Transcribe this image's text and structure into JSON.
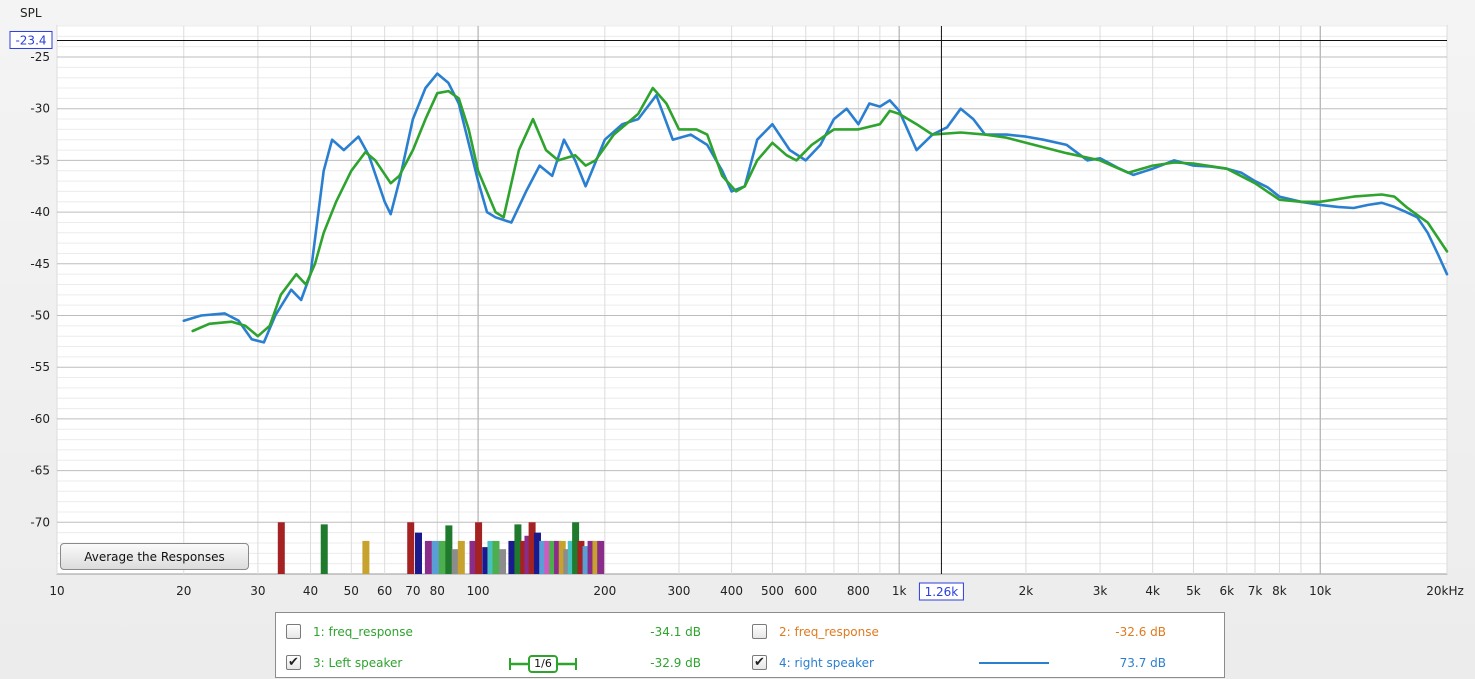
{
  "chart_data": {
    "type": "line",
    "ylabel": "SPL",
    "xlabel": "",
    "x_scale": "log",
    "xlim": [
      10,
      20000
    ],
    "ylim": [
      -75,
      -22
    ],
    "x_ticks": [
      {
        "v": 10,
        "label": "10"
      },
      {
        "v": 20,
        "label": "20"
      },
      {
        "v": 30,
        "label": "30"
      },
      {
        "v": 40,
        "label": "40"
      },
      {
        "v": 50,
        "label": "50"
      },
      {
        "v": 60,
        "label": "60"
      },
      {
        "v": 70,
        "label": "70"
      },
      {
        "v": 80,
        "label": "80"
      },
      {
        "v": 100,
        "label": "100"
      },
      {
        "v": 200,
        "label": "200"
      },
      {
        "v": 300,
        "label": "300"
      },
      {
        "v": 400,
        "label": "400"
      },
      {
        "v": 500,
        "label": "500"
      },
      {
        "v": 600,
        "label": "600"
      },
      {
        "v": 800,
        "label": "800"
      },
      {
        "v": 1000,
        "label": "1k"
      },
      {
        "v": 2000,
        "label": "2k"
      },
      {
        "v": 3000,
        "label": "3k"
      },
      {
        "v": 4000,
        "label": "4k"
      },
      {
        "v": 5000,
        "label": "5k"
      },
      {
        "v": 6000,
        "label": "6k"
      },
      {
        "v": 7000,
        "label": "7k"
      },
      {
        "v": 8000,
        "label": "8k"
      },
      {
        "v": 10000,
        "label": "10k"
      },
      {
        "v": 20000,
        "label": "20kHz"
      }
    ],
    "y_ticks": [
      -25,
      -30,
      -35,
      -40,
      -45,
      -50,
      -55,
      -60,
      -65,
      -70
    ],
    "grid": true,
    "cursor": {
      "x": 1260,
      "y": -23.4,
      "x_label": "1.26k",
      "y_label": "-23.4"
    },
    "series": [
      {
        "name": "right speaker",
        "color": "#2b7fd0",
        "points": [
          [
            20,
            -50.5
          ],
          [
            22,
            -50
          ],
          [
            25,
            -49.8
          ],
          [
            27,
            -50.5
          ],
          [
            29,
            -52.3
          ],
          [
            31,
            -52.6
          ],
          [
            33,
            -50
          ],
          [
            36,
            -47.5
          ],
          [
            38,
            -48.5
          ],
          [
            40,
            -46
          ],
          [
            43,
            -36
          ],
          [
            45,
            -33
          ],
          [
            48,
            -34
          ],
          [
            52,
            -32.7
          ],
          [
            55,
            -34.5
          ],
          [
            60,
            -39
          ],
          [
            62,
            -40.2
          ],
          [
            65,
            -37
          ],
          [
            70,
            -31
          ],
          [
            75,
            -28
          ],
          [
            80,
            -26.6
          ],
          [
            85,
            -27.5
          ],
          [
            90,
            -29.5
          ],
          [
            100,
            -37
          ],
          [
            105,
            -40
          ],
          [
            110,
            -40.5
          ],
          [
            120,
            -41
          ],
          [
            130,
            -38
          ],
          [
            140,
            -35.5
          ],
          [
            150,
            -36.5
          ],
          [
            160,
            -33
          ],
          [
            170,
            -35
          ],
          [
            180,
            -37.5
          ],
          [
            200,
            -33
          ],
          [
            220,
            -31.5
          ],
          [
            240,
            -31
          ],
          [
            265,
            -28.7
          ],
          [
            290,
            -33
          ],
          [
            320,
            -32.5
          ],
          [
            350,
            -33.5
          ],
          [
            380,
            -36
          ],
          [
            400,
            -38
          ],
          [
            430,
            -37.5
          ],
          [
            460,
            -33
          ],
          [
            500,
            -31.5
          ],
          [
            550,
            -34
          ],
          [
            600,
            -35
          ],
          [
            650,
            -33.5
          ],
          [
            700,
            -31
          ],
          [
            750,
            -30
          ],
          [
            800,
            -31.5
          ],
          [
            850,
            -29.5
          ],
          [
            900,
            -29.8
          ],
          [
            950,
            -29.2
          ],
          [
            1000,
            -30.2
          ],
          [
            1100,
            -34
          ],
          [
            1200,
            -32.5
          ],
          [
            1300,
            -31.8
          ],
          [
            1400,
            -30
          ],
          [
            1500,
            -31
          ],
          [
            1600,
            -32.5
          ],
          [
            1800,
            -32.5
          ],
          [
            2000,
            -32.7
          ],
          [
            2200,
            -33
          ],
          [
            2500,
            -33.5
          ],
          [
            2800,
            -35
          ],
          [
            3000,
            -34.8
          ],
          [
            3300,
            -35.7
          ],
          [
            3600,
            -36.4
          ],
          [
            4000,
            -35.8
          ],
          [
            4500,
            -35
          ],
          [
            5000,
            -35.5
          ],
          [
            5500,
            -35.6
          ],
          [
            6000,
            -35.8
          ],
          [
            6500,
            -36.2
          ],
          [
            7000,
            -37
          ],
          [
            7500,
            -37.6
          ],
          [
            8000,
            -38.5
          ],
          [
            9000,
            -39
          ],
          [
            10000,
            -39.3
          ],
          [
            11000,
            -39.5
          ],
          [
            12000,
            -39.6
          ],
          [
            13000,
            -39.3
          ],
          [
            14000,
            -39.1
          ],
          [
            15000,
            -39.5
          ],
          [
            16000,
            -40
          ],
          [
            17000,
            -40.5
          ],
          [
            18000,
            -42
          ],
          [
            19000,
            -44
          ],
          [
            20000,
            -46
          ]
        ]
      },
      {
        "name": "Left speaker",
        "color": "#2ea32e",
        "points": [
          [
            21,
            -51.5
          ],
          [
            23,
            -50.8
          ],
          [
            26,
            -50.6
          ],
          [
            28,
            -51
          ],
          [
            30,
            -52
          ],
          [
            32,
            -51
          ],
          [
            34,
            -48
          ],
          [
            37,
            -46
          ],
          [
            39,
            -47
          ],
          [
            41,
            -45
          ],
          [
            43,
            -42
          ],
          [
            46,
            -39
          ],
          [
            50,
            -36
          ],
          [
            54,
            -34.2
          ],
          [
            57,
            -35
          ],
          [
            62,
            -37.2
          ],
          [
            65,
            -36.5
          ],
          [
            70,
            -34
          ],
          [
            75,
            -31
          ],
          [
            80,
            -28.5
          ],
          [
            85,
            -28.3
          ],
          [
            90,
            -29
          ],
          [
            95,
            -32
          ],
          [
            100,
            -36
          ],
          [
            110,
            -40
          ],
          [
            115,
            -40.5
          ],
          [
            125,
            -34
          ],
          [
            135,
            -31
          ],
          [
            145,
            -34
          ],
          [
            155,
            -35
          ],
          [
            170,
            -34.5
          ],
          [
            180,
            -35.5
          ],
          [
            190,
            -35
          ],
          [
            210,
            -32.5
          ],
          [
            240,
            -30.5
          ],
          [
            260,
            -28
          ],
          [
            280,
            -29.5
          ],
          [
            300,
            -32
          ],
          [
            330,
            -32
          ],
          [
            350,
            -32.5
          ],
          [
            380,
            -36.5
          ],
          [
            410,
            -38
          ],
          [
            430,
            -37.5
          ],
          [
            460,
            -35
          ],
          [
            500,
            -33.3
          ],
          [
            540,
            -34.5
          ],
          [
            570,
            -35
          ],
          [
            620,
            -33.5
          ],
          [
            700,
            -32
          ],
          [
            800,
            -32
          ],
          [
            900,
            -31.5
          ],
          [
            950,
            -30.2
          ],
          [
            1000,
            -30.5
          ],
          [
            1100,
            -31.5
          ],
          [
            1200,
            -32.5
          ],
          [
            1400,
            -32.3
          ],
          [
            1600,
            -32.5
          ],
          [
            1800,
            -32.8
          ],
          [
            2000,
            -33.3
          ],
          [
            2500,
            -34.3
          ],
          [
            3000,
            -35
          ],
          [
            3500,
            -36.2
          ],
          [
            4000,
            -35.5
          ],
          [
            4500,
            -35.2
          ],
          [
            5000,
            -35.3
          ],
          [
            6000,
            -35.8
          ],
          [
            7000,
            -37.2
          ],
          [
            8000,
            -38.8
          ],
          [
            9000,
            -39
          ],
          [
            10000,
            -39
          ],
          [
            12000,
            -38.5
          ],
          [
            14000,
            -38.3
          ],
          [
            15000,
            -38.5
          ],
          [
            16000,
            -39.5
          ],
          [
            18000,
            -41
          ],
          [
            20000,
            -43.8
          ]
        ]
      }
    ],
    "markers": [
      {
        "f": 34,
        "h": -70,
        "c": "#a52222"
      },
      {
        "f": 43,
        "h": -70.2,
        "c": "#1f7a2e"
      },
      {
        "f": 54,
        "h": -71.8,
        "c": "#c8a22e"
      },
      {
        "f": 69,
        "h": -70,
        "c": "#a52222"
      },
      {
        "f": 72,
        "h": -71,
        "c": "#1a1a8c"
      },
      {
        "f": 76,
        "h": -71.8,
        "c": "#8a2d8a"
      },
      {
        "f": 79,
        "h": -71.8,
        "c": "#5a9ed6"
      },
      {
        "f": 82,
        "h": -71.8,
        "c": "#4cae4c"
      },
      {
        "f": 85,
        "h": -70.3,
        "c": "#1f7a2e"
      },
      {
        "f": 88,
        "h": -72.6,
        "c": "#8c8c8c"
      },
      {
        "f": 91,
        "h": -71.8,
        "c": "#c8a22e"
      },
      {
        "f": 97,
        "h": -71.8,
        "c": "#8a2d8a"
      },
      {
        "f": 100,
        "h": -70,
        "c": "#a52222"
      },
      {
        "f": 104,
        "h": -72.4,
        "c": "#1a1a8c"
      },
      {
        "f": 107,
        "h": -71.8,
        "c": "#46c0c0"
      },
      {
        "f": 110,
        "h": -71.8,
        "c": "#4cae4c"
      },
      {
        "f": 114,
        "h": -72.6,
        "c": "#8c8c8c"
      },
      {
        "f": 120,
        "h": -71.8,
        "c": "#1a1a8c"
      },
      {
        "f": 124,
        "h": -70.2,
        "c": "#1f7a2e"
      },
      {
        "f": 128,
        "h": -71.8,
        "c": "#a52222"
      },
      {
        "f": 131,
        "h": -71.3,
        "c": "#8a2d8a"
      },
      {
        "f": 134,
        "h": -70,
        "c": "#a52222"
      },
      {
        "f": 138,
        "h": -71,
        "c": "#1a1a8c"
      },
      {
        "f": 142,
        "h": -71.8,
        "c": "#5a9ed6"
      },
      {
        "f": 146,
        "h": -71.8,
        "c": "#d05ac0"
      },
      {
        "f": 150,
        "h": -71.8,
        "c": "#4cae4c"
      },
      {
        "f": 154,
        "h": -71.8,
        "c": "#8a2d8a"
      },
      {
        "f": 158,
        "h": -71.8,
        "c": "#c8a22e"
      },
      {
        "f": 162,
        "h": -72.6,
        "c": "#8c8c8c"
      },
      {
        "f": 166,
        "h": -71.8,
        "c": "#46c0c0"
      },
      {
        "f": 170,
        "h": -70,
        "c": "#1f7a2e"
      },
      {
        "f": 175,
        "h": -71.8,
        "c": "#a52222"
      },
      {
        "f": 180,
        "h": -72.3,
        "c": "#5a9ed6"
      },
      {
        "f": 185,
        "h": -71.8,
        "c": "#8a2d8a"
      },
      {
        "f": 190,
        "h": -71.8,
        "c": "#c8a22e"
      },
      {
        "f": 195,
        "h": -71.8,
        "c": "#8a2d8a"
      }
    ]
  },
  "button": {
    "label": "Average the Responses"
  },
  "legend": {
    "rows": [
      [
        {
          "label": "1: freq_response",
          "checked": false,
          "check_glyph": "",
          "value": "-34.1 dB",
          "color": "#2ea32e",
          "swatch": "none"
        },
        {
          "label": "2: freq_response",
          "checked": false,
          "check_glyph": "",
          "value": "-32.6 dB",
          "color": "#e07a1f",
          "swatch": "none"
        }
      ],
      [
        {
          "label": "3: Left speaker",
          "checked": true,
          "check_glyph": "✔",
          "value": "-32.9 dB",
          "color": "#2ea32e",
          "swatch": "smoothing",
          "swatch_text": "1/6"
        },
        {
          "label": "4: right speaker",
          "checked": true,
          "check_glyph": "✔",
          "value": "73.7 dB",
          "color": "#2b7fd0",
          "swatch": "line"
        }
      ]
    ]
  }
}
